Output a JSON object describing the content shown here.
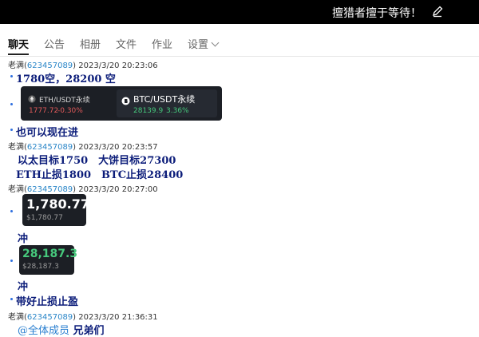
{
  "title_bar": {
    "title": "擅猎者擅于等待！",
    "icon": "edit-icon"
  },
  "tabs": [
    {
      "label": "聊天",
      "active": true
    },
    {
      "label": "公告"
    },
    {
      "label": "相册"
    },
    {
      "label": "文件"
    },
    {
      "label": "作业"
    },
    {
      "label": "设置"
    }
  ],
  "messages": [
    {
      "sender": "老满",
      "uid": "623457089",
      "time": "2023/3/20 20:23:06"
    },
    {
      "sender": "老满",
      "uid": "623457089",
      "time": "2023/3/20 20:23:57"
    },
    {
      "sender": "老满",
      "uid": "623457089",
      "time": "2023/3/20 20:27:00"
    },
    {
      "sender": "老满",
      "uid": "623457089",
      "time": "2023/3/20 21:36:31"
    }
  ],
  "lines": {
    "l1": "1780空，28200 空",
    "l2": "也可以现在进",
    "l3": "以太目标1750　大饼目标27300",
    "l4": "ETH止损1800　BTC止损28400",
    "l5": "冲",
    "l6": "冲",
    "l7": "带好止损止盈",
    "l8_at": "@全体成员",
    "l8_text": "兄弟们"
  },
  "ticker_pair": {
    "eth": {
      "label": "ETH/USDT永续",
      "price": "1777.72",
      "change": "-0.30%"
    },
    "btc": {
      "label": "BTC/USDT永续",
      "price": "28139.9",
      "change": "3.36%"
    }
  },
  "price_card_1": {
    "price": "1,780.77",
    "sub": "$1,780.77"
  },
  "price_card_2": {
    "price": "28,187.3",
    "sub": "$28,187.3"
  },
  "colors": {
    "negative": "#e15a5a",
    "positive": "#46c87c",
    "uid": "#2a86c8",
    "text": "#0c1d7a"
  }
}
